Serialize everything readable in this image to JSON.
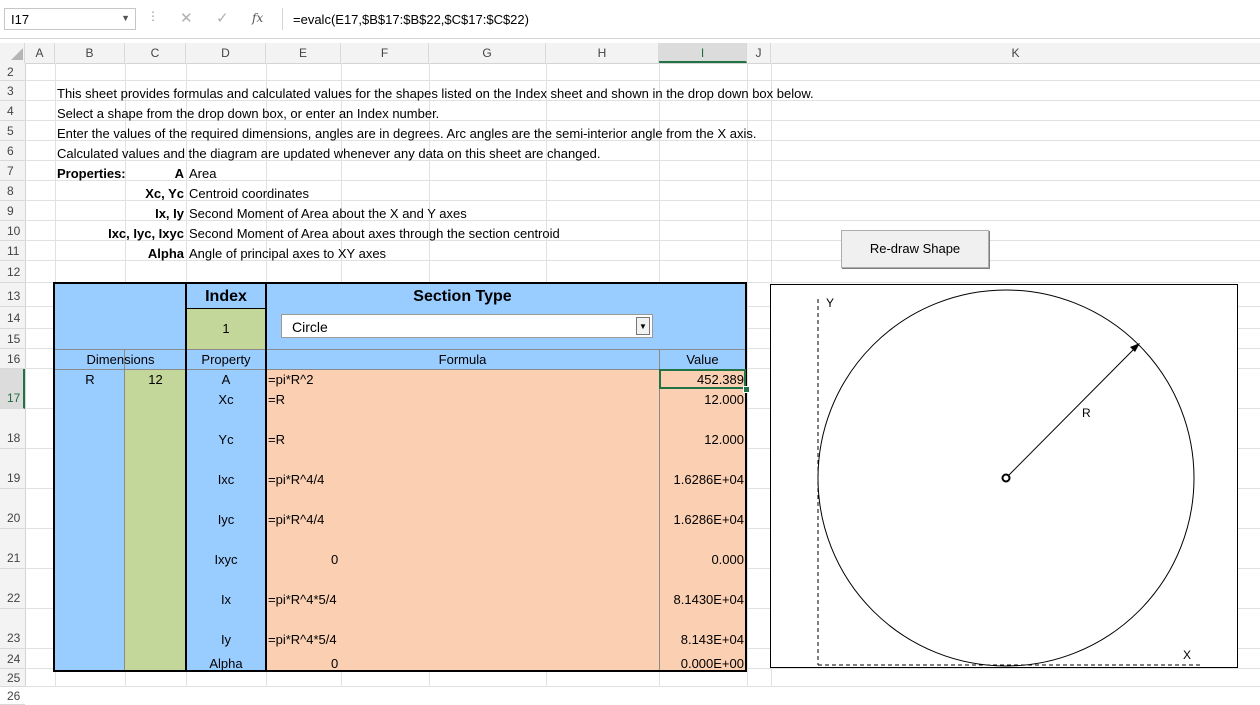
{
  "formula_bar": {
    "name_box": "I17",
    "fx_icon": "fx",
    "formula": "=evalc(E17,$B$17:$B$22,$C$17:$C$22)"
  },
  "columns": [
    "A",
    "B",
    "C",
    "D",
    "E",
    "F",
    "G",
    "H",
    "I",
    "J",
    "K"
  ],
  "rows": [
    "2",
    "3",
    "4",
    "5",
    "6",
    "7",
    "8",
    "9",
    "10",
    "11",
    "12",
    "13",
    "14",
    "15",
    "16",
    "17",
    "18",
    "19",
    "20",
    "21",
    "22",
    "23",
    "24",
    "25",
    "26"
  ],
  "intro": {
    "line1": "This sheet provides formulas and calculated values for the shapes listed on the Index sheet and shown in the drop down box below.",
    "line2": "Select a shape from the drop down box, or enter an Index number.",
    "line3": "Enter the values of the required dimensions, angles are in degrees.  Arc angles are the semi-interior angle from the X axis.",
    "line4": "Calculated values and the diagram are updated whenever any data on this sheet are changed.",
    "properties_label": "Properties:",
    "legend": [
      {
        "key": "A",
        "desc": "Area"
      },
      {
        "key": "Xc, Yc",
        "desc": "Centroid coordinates"
      },
      {
        "key": "Ix, Iy",
        "desc": "Second Moment of Area about the X and Y axes"
      },
      {
        "key": "Ixc, Iyc, Ixyc",
        "desc": "Second Moment of Area about axes through the section centroid"
      },
      {
        "key": "Alpha",
        "desc": "Angle of principal axes to XY axes"
      }
    ]
  },
  "redraw_button": "Re-draw Shape",
  "table": {
    "index_header": "Index",
    "index_value": "1",
    "section_type_header": "Section Type",
    "section_type_value": "Circle",
    "dimensions_header": "Dimensions",
    "property_header": "Property",
    "formula_header": "Formula",
    "value_header": "Value",
    "dim_name": "R",
    "dim_value": "12",
    "props": [
      {
        "name": "A",
        "formula": "=pi*R^2",
        "value": "452.389"
      },
      {
        "name": "Xc",
        "formula": "=R",
        "value": "12.000"
      },
      {
        "name": "Yc",
        "formula": "=R",
        "value": "12.000"
      },
      {
        "name": "Ixc",
        "formula": "=pi*R^4/4",
        "value": "1.6286E+04"
      },
      {
        "name": "Iyc",
        "formula": "=pi*R^4/4",
        "value": "1.6286E+04"
      },
      {
        "name": "Ixyc",
        "formula": "0",
        "value": "0.000"
      },
      {
        "name": "Ix",
        "formula": "=pi*R^4*5/4",
        "value": "8.1430E+04"
      },
      {
        "name": "Iy",
        "formula": "=pi*R^4*5/4",
        "value": "8.143E+04"
      },
      {
        "name": "Alpha",
        "formula": "0",
        "value": "0.000E+00"
      }
    ]
  },
  "diagram": {
    "y_label": "Y",
    "x_label": "X",
    "radius_label": "R"
  },
  "colors": {
    "blue": "#99ccff",
    "green": "#c4d79b",
    "peach": "#fbd0b2",
    "excel_green": "#217346"
  }
}
